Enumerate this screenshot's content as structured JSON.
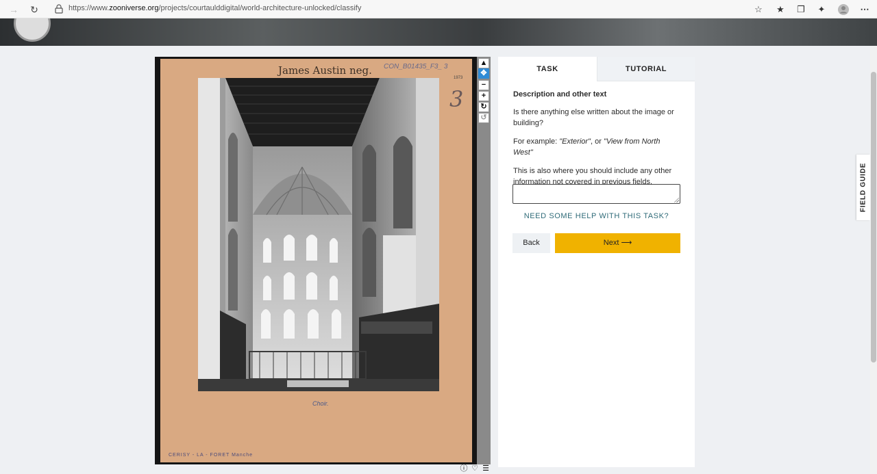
{
  "browser": {
    "url_prefix": "https://www.",
    "url_domain": "zooniverse.org",
    "url_path": "/projects/courtaulddigital/world-architecture-unlocked/classify"
  },
  "image": {
    "header_text": "James Austin neg.",
    "ref_text": "CON_B01435_F3_ 3",
    "small_number": "1973",
    "big_number": "3",
    "caption": "Choir.",
    "bottom_text": "CERISY  -  LA  -  FORET       Manche"
  },
  "viewer_tools": [
    "pointer-icon",
    "move-icon",
    "zoom-out-icon",
    "zoom-in-icon",
    "rotate-icon",
    "reset-icon"
  ],
  "tabs": {
    "task": "TASK",
    "tutorial": "TUTORIAL"
  },
  "task": {
    "heading": "Description and other text",
    "question": "Is there anything else written about the image or building?",
    "example_prefix": "For example: ",
    "example_1": "\"Exterior\"",
    "example_sep": ", or ",
    "example_2": "\"View from North West\"",
    "note": "This is also where you should include any other information not covered in previous fields.",
    "answer_value": "",
    "help_link": "NEED SOME HELP WITH THIS TASK?",
    "back_label": "Back",
    "next_label": "Next",
    "next_icon": "arrow-right-icon"
  },
  "field_guide": "FIELD GUIDE",
  "colors": {
    "accent": "#f0b200",
    "link": "#2f6b78",
    "active_tool": "#2f8bd6"
  }
}
